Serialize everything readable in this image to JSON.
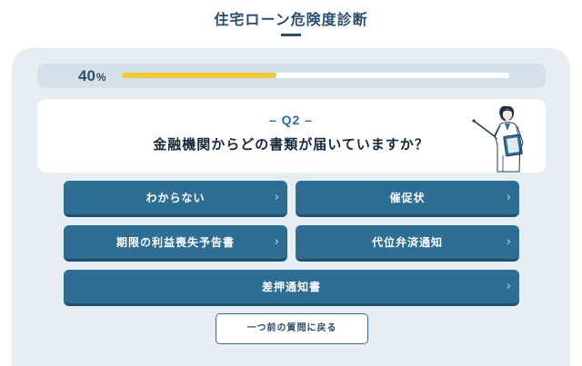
{
  "header": {
    "title": "住宅ローン危険度診断"
  },
  "progress": {
    "value": "40",
    "unit": "%",
    "fraction": 0.4
  },
  "question": {
    "number": "– Q2 –",
    "text": "金融機関からどの書類が届いていますか？"
  },
  "options": [
    {
      "label": "わからない",
      "chevron": "›"
    },
    {
      "label": "催促状",
      "chevron": "›"
    },
    {
      "label": "期限の利益喪失予告書",
      "chevron": "›"
    },
    {
      "label": "代位弁済通知",
      "chevron": "›"
    },
    {
      "label": "差押通知書",
      "chevron": "›"
    }
  ],
  "back_button": {
    "label": "一つ前の質問に戻る"
  },
  "colors": {
    "primary": "#2e6d94",
    "accent": "#f3c93a",
    "panel": "#e6edf3",
    "title": "#2a4d6e"
  },
  "icons": {
    "option_arrow": "chevron-right-icon",
    "illustration": "woman-with-pointer-and-clipboard"
  }
}
